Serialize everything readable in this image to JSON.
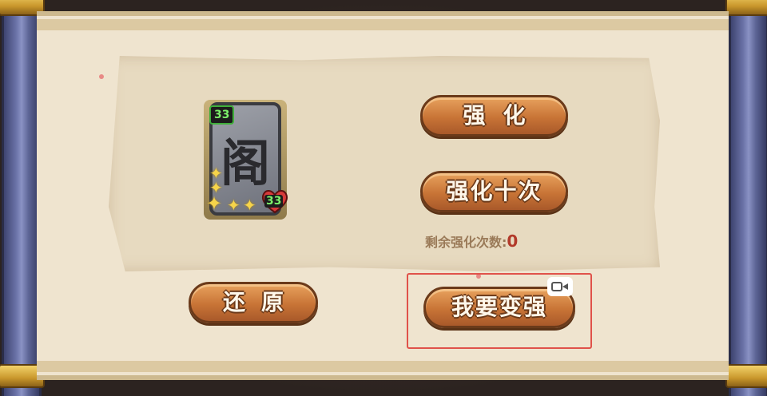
{
  "card": {
    "glyph": "阁",
    "attack": "33",
    "health": "33",
    "star_count": 5
  },
  "buttons": {
    "enhance": "强化",
    "enhance_ten": "强化十次",
    "restore": "还原",
    "get_stronger": "我要变强"
  },
  "remaining": {
    "label": "剩余强化次数:",
    "value": "0"
  },
  "icons": {
    "video": "video-icon"
  },
  "colors": {
    "button": "#c87436",
    "highlight": "#e0524a",
    "stat_green": "#7cf06a",
    "heart": "#d63a3a"
  }
}
